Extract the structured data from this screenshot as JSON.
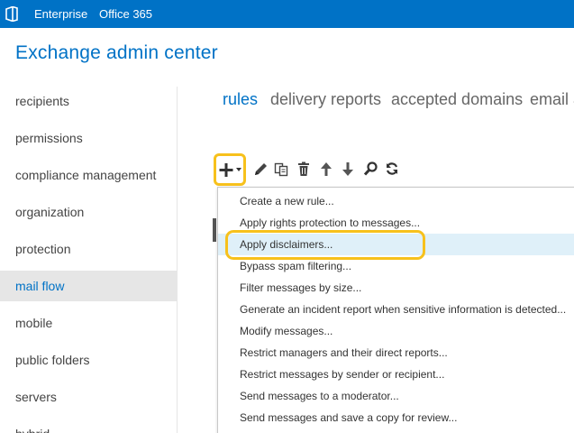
{
  "topbar": {
    "tabs": [
      "Enterprise",
      "Office 365"
    ],
    "logo_icon": "office-logo-icon"
  },
  "app": {
    "title": "Exchange admin center"
  },
  "nav": {
    "items": [
      "recipients",
      "permissions",
      "compliance management",
      "organization",
      "protection",
      "mail flow",
      "mobile",
      "public folders",
      "servers",
      "hybrid"
    ],
    "active": "mail flow"
  },
  "subtabs": {
    "items": [
      "rules",
      "delivery reports",
      "accepted domains",
      "email a"
    ],
    "active": "rules"
  },
  "toolbar": {
    "icons": [
      "add-icon",
      "dropdown-caret-icon",
      "edit-icon",
      "copy-icon",
      "delete-icon",
      "move-up-icon",
      "move-down-icon",
      "search-icon",
      "refresh-icon"
    ]
  },
  "menu": {
    "items": [
      "Create a new rule...",
      "Apply rights protection to messages...",
      "Apply disclaimers...",
      "Bypass spam filtering...",
      "Filter messages by size...",
      "Generate an incident report when sensitive information is detected...",
      "Modify messages...",
      "Restrict managers and their direct reports...",
      "Restrict messages by sender or recipient...",
      "Send messages to a moderator...",
      "Send messages and save a copy for review..."
    ],
    "hovered": "Apply disclaimers..."
  },
  "colors": {
    "accent": "#0072c6",
    "highlight": "#f7c11c",
    "hover": "#dff0f9",
    "nav_active_bg": "#e6e6e6"
  }
}
